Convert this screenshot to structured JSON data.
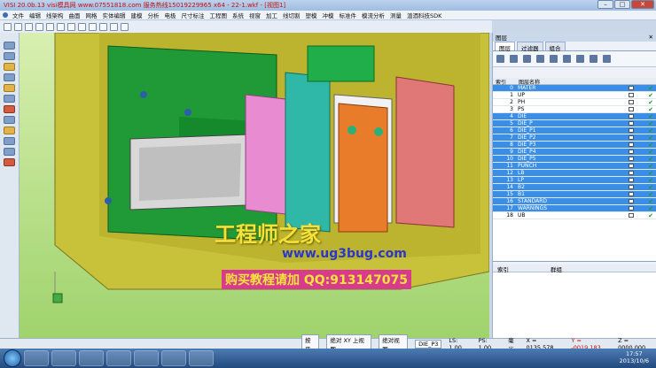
{
  "window": {
    "title": "VISI 20.0b.13 visi模具网 www.07551818.com 服务热线15019229965 x64 - 22-1.wkf - [视图1]"
  },
  "menu": [
    "文件",
    "编辑",
    "线架构",
    "曲面",
    "网格",
    "实体编辑",
    "建模",
    "分析",
    "电极",
    "尺寸标注",
    "工程图",
    "系统",
    "视窗",
    "加工",
    "线切割",
    "塑模",
    "冲模",
    "标准件",
    "模流分析",
    "测量",
    "渲酒科技SDK"
  ],
  "panel": {
    "header": "图层",
    "tabs": [
      "图层",
      "过滤器",
      "组合"
    ],
    "columns": {
      "index": "索引",
      "name": "图层名称"
    },
    "layers": [
      {
        "idx": "0",
        "name": "MATER",
        "selected": true
      },
      {
        "idx": "1",
        "name": "UP",
        "selected": false
      },
      {
        "idx": "2",
        "name": "PH",
        "selected": false
      },
      {
        "idx": "3",
        "name": "PS",
        "selected": false
      },
      {
        "idx": "4",
        "name": "DIE",
        "selected": true
      },
      {
        "idx": "5",
        "name": "DIE_P",
        "selected": true
      },
      {
        "idx": "6",
        "name": "DIE_P1",
        "selected": true
      },
      {
        "idx": "7",
        "name": "DIE_P2",
        "selected": true
      },
      {
        "idx": "8",
        "name": "DIE_P3",
        "selected": true
      },
      {
        "idx": "9",
        "name": "DIE_P4",
        "selected": true
      },
      {
        "idx": "10",
        "name": "DIE_P5",
        "selected": true
      },
      {
        "idx": "11",
        "name": "PUNCH",
        "selected": true
      },
      {
        "idx": "12",
        "name": "LB",
        "selected": true
      },
      {
        "idx": "13",
        "name": "LP",
        "selected": true
      },
      {
        "idx": "14",
        "name": "B2",
        "selected": true
      },
      {
        "idx": "15",
        "name": "B1",
        "selected": true
      },
      {
        "idx": "16",
        "name": "STANDARD",
        "selected": true
      },
      {
        "idx": "17",
        "name": "WARNINGS",
        "selected": true
      },
      {
        "idx": "18",
        "name": "UB",
        "selected": false
      }
    ],
    "group_columns": {
      "index": "索引",
      "name": "群组"
    }
  },
  "watermark": {
    "brand": "工程师之家",
    "site": "www.ug3bug.com",
    "promo": "购买教程请加 QQ:913147075"
  },
  "status": {
    "button1": "按平",
    "view_label": "绝对 XY 上视图",
    "view2": "绝对视图",
    "layer": "DIE_P3",
    "ls": "LS: 1.00",
    "ps": "PS: 1.00",
    "unit": "毫米",
    "x": "X = 0135.578",
    "y": "Y = -0019.183",
    "z": "Z = 0000.000"
  },
  "clock": {
    "time": "17:57",
    "date": "2013/10/6"
  },
  "colors": {
    "viewport_bg": "#b5e08a",
    "mold_yellow": "#c8c23a",
    "green_block": "#1f9a37",
    "pink_block": "#e98bd1",
    "orange_block": "#e87c2a",
    "salmon_block": "#e07878",
    "teal_block": "#2fb8a8"
  }
}
